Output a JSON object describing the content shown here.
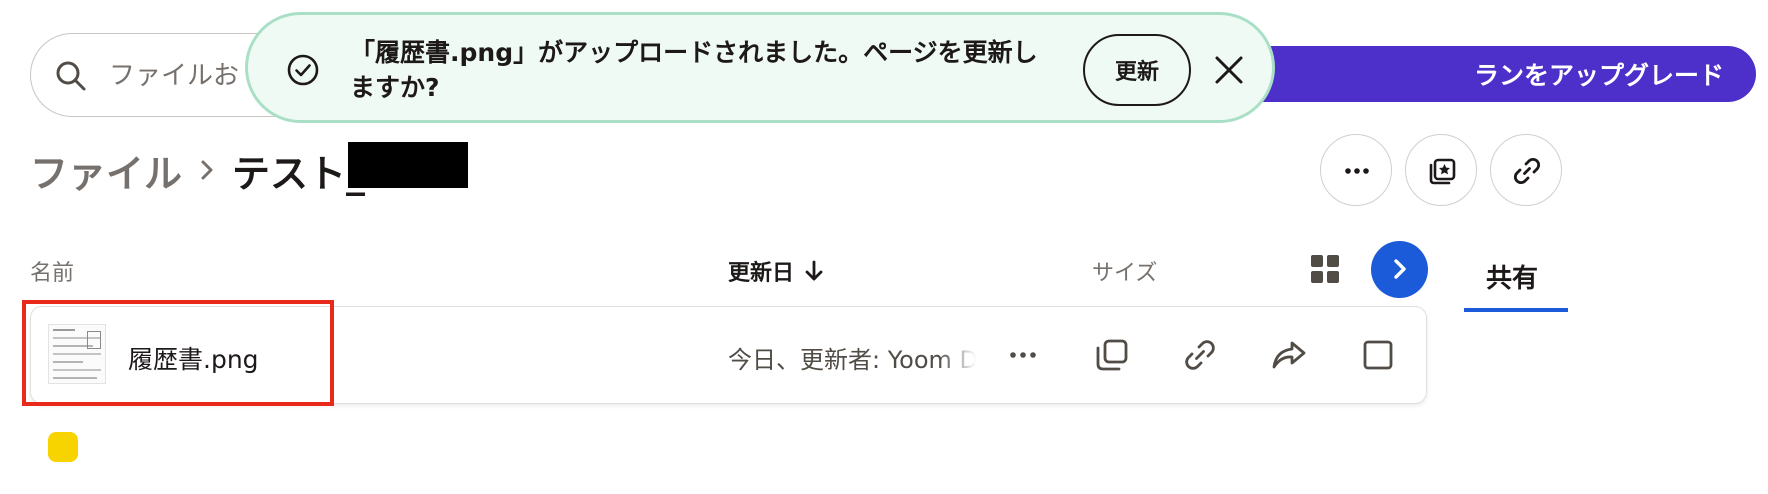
{
  "search": {
    "placeholder": "ファイルお"
  },
  "upgrade": {
    "label": "ランをアップグレード"
  },
  "toast": {
    "message": "「履歴書.png」がアップロードされました。ページを更新しますか?",
    "refresh_label": "更新"
  },
  "breadcrumb": {
    "root": "ファイル",
    "current": "テスト_"
  },
  "columns": {
    "name": "名前",
    "modified": "更新日",
    "size": "サイズ"
  },
  "sidebar_tab": {
    "label": "共有"
  },
  "file": {
    "name": "履歴書.png",
    "modified": "今日、更新者: Yoom D"
  },
  "colors": {
    "accent": "#1b5ad8",
    "upgrade": "#4d2fc9",
    "toast_bg": "#effaf4",
    "highlight": "#e8291c"
  },
  "icons": [
    "search-icon",
    "check-circle-icon",
    "close-icon",
    "chevron-right-icon",
    "more-icon",
    "star-folder-icon",
    "link-icon",
    "arrow-down-icon",
    "grid-view-icon",
    "copy-icon",
    "share-icon",
    "checkbox-icon"
  ]
}
